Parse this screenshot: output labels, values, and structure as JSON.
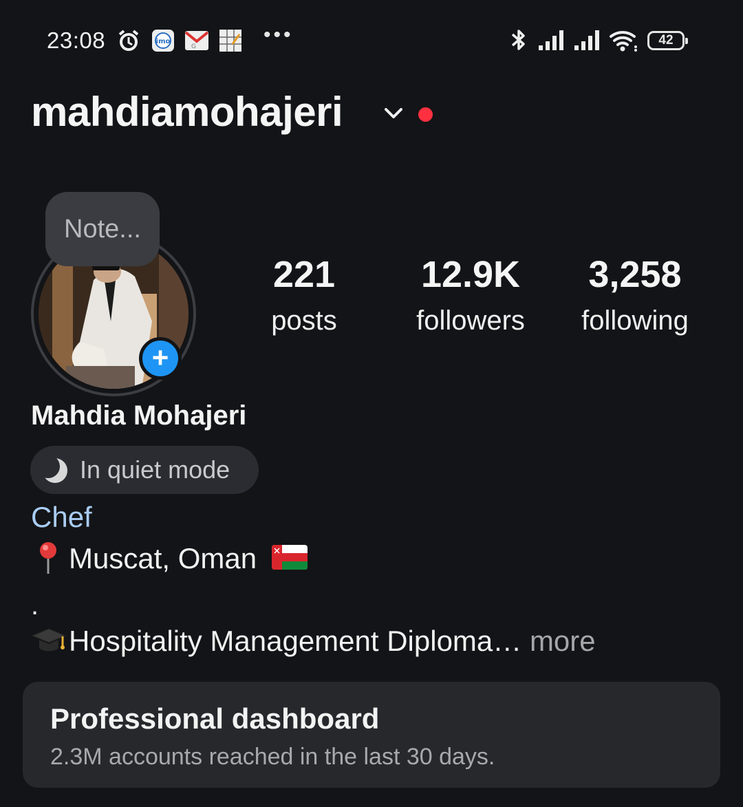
{
  "status_bar": {
    "time": "23:08",
    "notification_icons": [
      "alarm-icon",
      "imo-icon",
      "gmail-icon",
      "sudoku-icon"
    ],
    "more": "•••",
    "battery": "42",
    "system_icons": [
      "bluetooth-icon",
      "signal-icon",
      "signal-icon",
      "wifi-icon",
      "battery-icon"
    ]
  },
  "header": {
    "username": "mahdiamohajeri",
    "accent_color": "#ff3040"
  },
  "profile": {
    "note_placeholder": "Note...",
    "stats": [
      {
        "value": "221",
        "label": "posts"
      },
      {
        "value": "12.9K",
        "label": "followers"
      },
      {
        "value": "3,258",
        "label": "following"
      }
    ],
    "full_name": "Mahdia Mohajeri",
    "status_pill": "In quiet mode",
    "category": "Chef",
    "location": "Muscat, Oman",
    "bio_dot": ".",
    "bio_line": "Hospitality Management Diploma…",
    "bio_more": " more"
  },
  "dashboard": {
    "title": "Professional dashboard",
    "subtitle": "2.3M accounts reached in the last 30 days."
  },
  "colors": {
    "background": "#131417",
    "link": "#a9cdf3",
    "primary_blue": "#1e95f4"
  }
}
